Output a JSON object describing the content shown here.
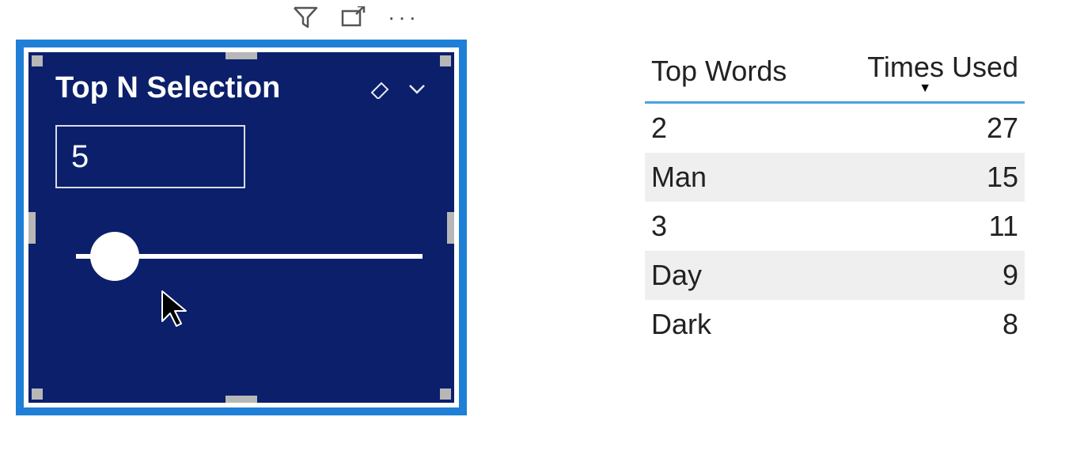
{
  "colors": {
    "selection_border": "#1f7fd6",
    "slicer_bg": "#0b1f6b",
    "table_underline": "#4aa3e0"
  },
  "visual_header": {
    "filter_icon": "filter-icon",
    "focus_icon": "focus-mode-icon",
    "more_icon": "more-options-icon"
  },
  "slicer": {
    "title": "Top N Selection",
    "clear_icon": "eraser-icon",
    "dropdown_icon": "chevron-down-icon",
    "value": "5",
    "slider": {
      "min": 1,
      "max": 50,
      "value": 5
    }
  },
  "table": {
    "columns": [
      {
        "label": "Top Words",
        "sorted": false
      },
      {
        "label": "Times Used",
        "sorted": "desc"
      }
    ],
    "rows": [
      {
        "word": "2",
        "count": "27"
      },
      {
        "word": "Man",
        "count": "15"
      },
      {
        "word": "3",
        "count": "11"
      },
      {
        "word": "Day",
        "count": "9"
      },
      {
        "word": "Dark",
        "count": "8"
      }
    ]
  }
}
